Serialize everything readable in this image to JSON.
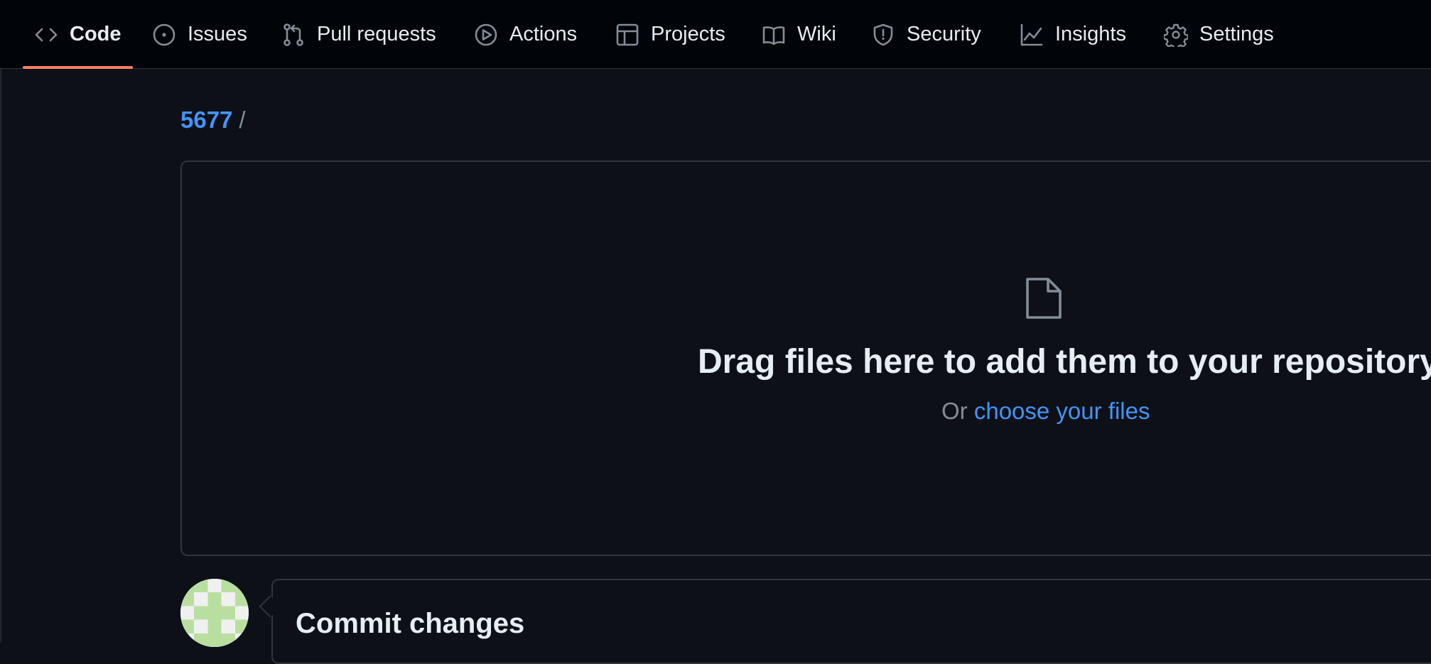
{
  "nav": {
    "tabs": [
      {
        "label": "Code",
        "icon": "code-icon",
        "active": true
      },
      {
        "label": "Issues",
        "icon": "issue-opened-icon",
        "active": false
      },
      {
        "label": "Pull requests",
        "icon": "git-pull-request-icon",
        "active": false
      },
      {
        "label": "Actions",
        "icon": "play-icon",
        "active": false
      },
      {
        "label": "Projects",
        "icon": "table-icon",
        "active": false
      },
      {
        "label": "Wiki",
        "icon": "book-icon",
        "active": false
      },
      {
        "label": "Security",
        "icon": "shield-icon",
        "active": false
      },
      {
        "label": "Insights",
        "icon": "graph-icon",
        "active": false
      },
      {
        "label": "Settings",
        "icon": "gear-icon",
        "active": false
      }
    ]
  },
  "breadcrumb": {
    "repo": "5677",
    "separator": "/"
  },
  "dropzone": {
    "icon": "file-icon",
    "title": "Drag files here to add them to your repository",
    "sub_prefix": "Or",
    "sub_link": "choose your files"
  },
  "commit": {
    "title": "Commit changes"
  },
  "colors": {
    "background": "#0d1117",
    "nav_background": "#010409",
    "link": "#4493f8",
    "active_tab_underline": "#f78166",
    "muted_text": "#848d97",
    "border": "#30363d"
  }
}
